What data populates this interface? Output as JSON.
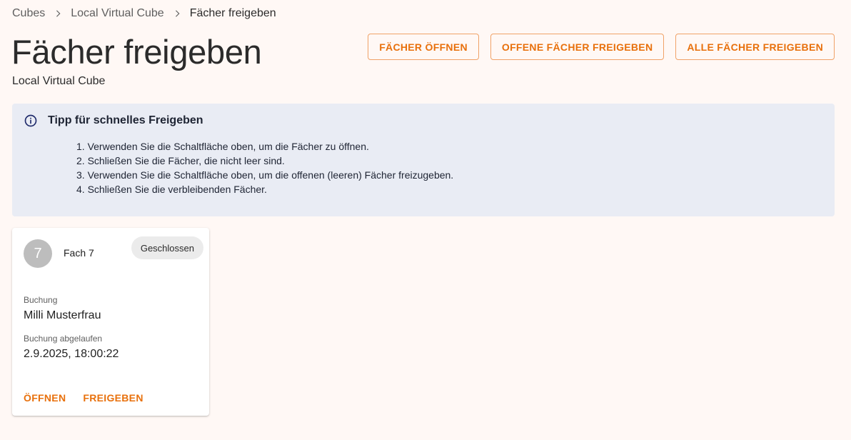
{
  "breadcrumb": {
    "items": [
      "Cubes",
      "Local Virtual Cube"
    ],
    "current": "Fächer freigeben"
  },
  "header": {
    "title": "Fächer freigeben",
    "subtitle": "Local Virtual Cube",
    "actions": {
      "open_all": "FÄCHER ÖFFNEN",
      "release_open": "OFFENE FÄCHER FREIGEBEN",
      "release_all": "ALLE FÄCHER FREIGEBEN"
    }
  },
  "info": {
    "title": "Tipp für schnelles Freigeben",
    "steps": [
      "1. Verwenden Sie die Schaltfläche oben, um die Fächer zu öffnen.",
      "2. Schließen Sie die Fächer, die nicht leer sind.",
      "3. Verwenden Sie die Schaltfläche oben, um die offenen (leeren) Fächer freizugeben.",
      "4. Schließen Sie die verbleibenden Fächer."
    ],
    "icon": "info-icon"
  },
  "compartments": [
    {
      "number": "7",
      "name": "Fach 7",
      "status": "Geschlossen",
      "booking_label": "Buchung",
      "booking_value": "Milli Musterfrau",
      "expired_label": "Buchung abgelaufen",
      "expired_value": "2.9.2025, 18:00:22",
      "open_label": "ÖFFNEN",
      "release_label": "FREIGEBEN"
    }
  ],
  "colors": {
    "accent": "#e8700c",
    "background": "#fff8f5",
    "info_background": "#e9ecf4"
  }
}
